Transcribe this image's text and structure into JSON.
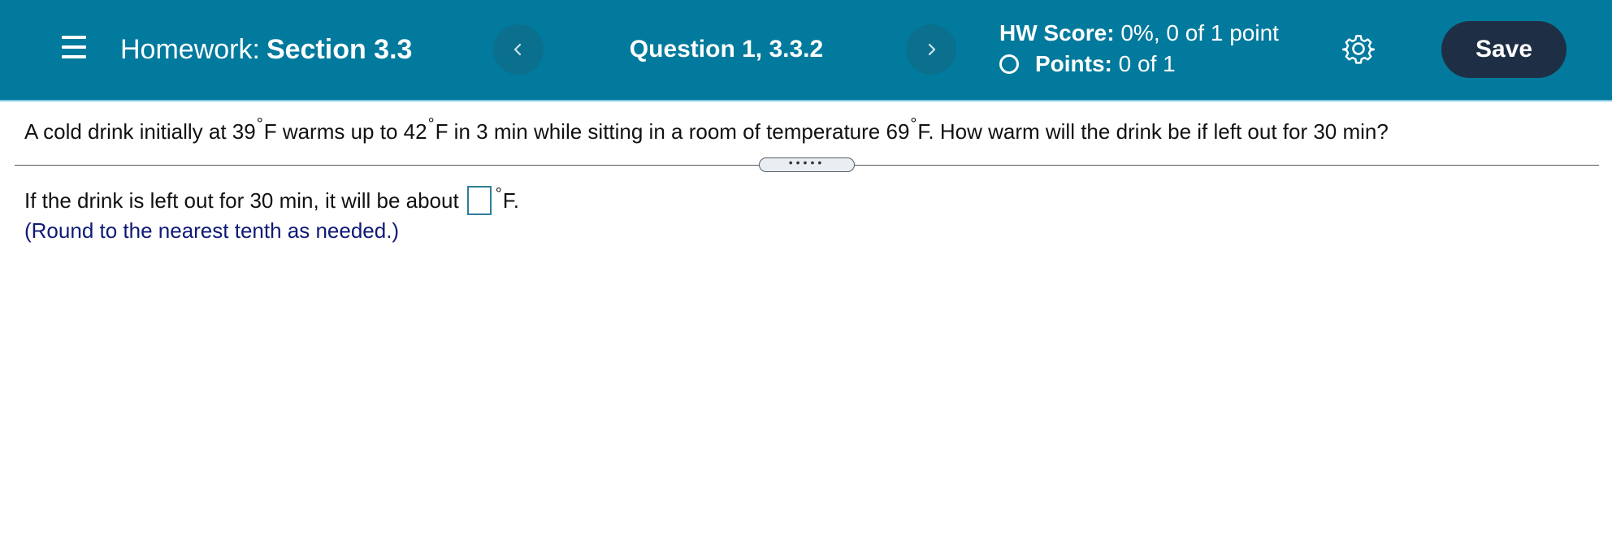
{
  "header": {
    "homework_prefix": "Homework:",
    "section_title": "Section 3.3",
    "question_label": "Question 1, 3.3.2",
    "hw_score_label": "HW Score:",
    "hw_score_value": "0%, 0 of 1 point",
    "points_label": "Points:",
    "points_value": "0 of 1",
    "save_label": "Save",
    "colors": {
      "header_bg": "#027a9d",
      "save_bg": "#1e2f45"
    },
    "icons": {
      "menu": "menu-icon",
      "prev": "chevron-left-icon",
      "next": "chevron-right-icon",
      "settings": "gear-icon",
      "status": "circle-outline-icon"
    }
  },
  "question": {
    "part1": "A cold drink initially at 39",
    "part2": "F warms up to 42",
    "part3": "F in 3 min while sitting in a room of temperature 69",
    "part4": "F. How warm will the drink be if left out for 30 min?",
    "degree_symbol": "°"
  },
  "divider": {
    "handle_dots": "•••••"
  },
  "answer": {
    "prompt": "If the drink is left out for 30 min, it will be about",
    "input_value": "",
    "degree_symbol": "°",
    "unit": "F.",
    "hint": "(Round to the nearest tenth as needed.)"
  }
}
